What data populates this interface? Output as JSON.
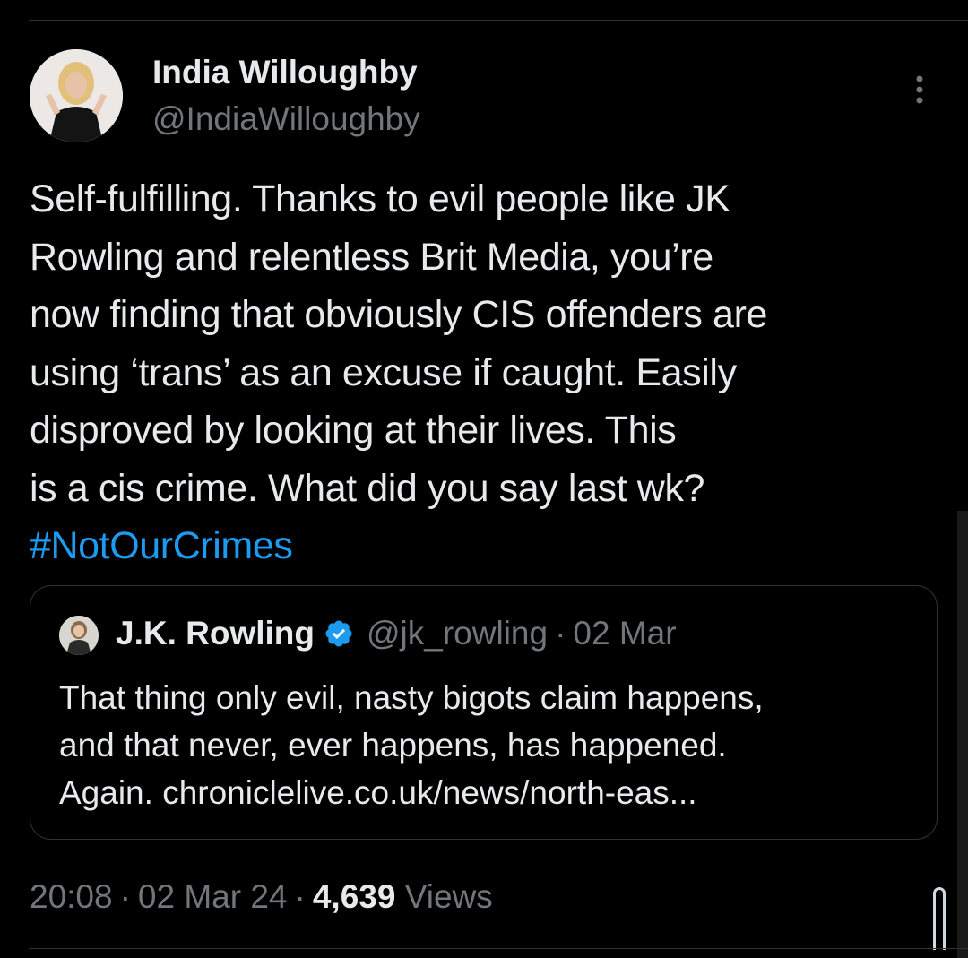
{
  "tweet": {
    "author": {
      "display_name": "India Willoughby",
      "handle": "@IndiaWilloughby",
      "avatar_icon": "profile-photo"
    },
    "more_icon": "more-vertical-icon",
    "text_lines": [
      "Self-fulfilling. Thanks to evil people like JK",
      "Rowling and relentless Brit Media, you’re",
      "now finding that obviously CIS offenders are",
      "using ‘trans’ as an excuse if caught. Easily",
      "disproved by looking at their lives. This",
      "is a cis crime. What did you say last wk?"
    ],
    "hashtag": "#NotOurCrimes",
    "quoted": {
      "display_name": "J.K. Rowling",
      "verified_icon": "verified-badge-icon",
      "handle": "@jk_rowling",
      "separator": "·",
      "date": "02 Mar",
      "text_lines": [
        "That thing only evil, nasty bigots claim happens,",
        "and that never, ever happens, has happened.",
        "Again.  chroniclelive.co.uk/news/north-eas..."
      ]
    },
    "meta": {
      "time": "20:08",
      "separator": "·",
      "date": "02 Mar 24",
      "views_count": "4,639",
      "views_label": "Views"
    }
  },
  "colors": {
    "background": "#000000",
    "text_primary": "#e7e9ea",
    "text_secondary": "#71767b",
    "accent": "#1d9bf0",
    "border": "#2f3336"
  }
}
